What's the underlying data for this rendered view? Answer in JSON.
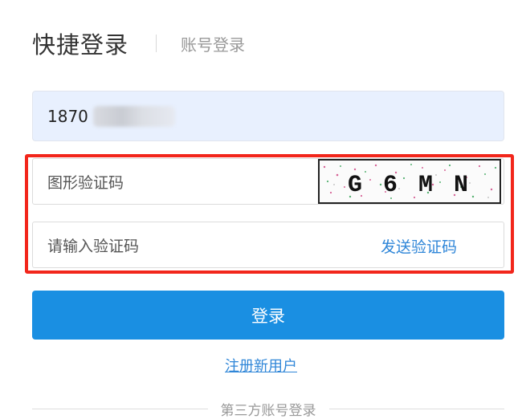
{
  "tabs": {
    "active": "快捷登录",
    "inactive": "账号登录"
  },
  "phone": {
    "value": "1870"
  },
  "captcha": {
    "placeholder": "图形验证码",
    "image_text": "G 6 M N"
  },
  "sms": {
    "placeholder": "请输入验证码",
    "send_label": "发送验证码"
  },
  "login_button": "登录",
  "register_link": "注册新用户",
  "third_party": "第三方账号登录",
  "colors": {
    "primary": "#1a8fe2",
    "link": "#2f86d8",
    "highlight": "#f2261b",
    "autofill_bg": "#e8f0fe"
  }
}
